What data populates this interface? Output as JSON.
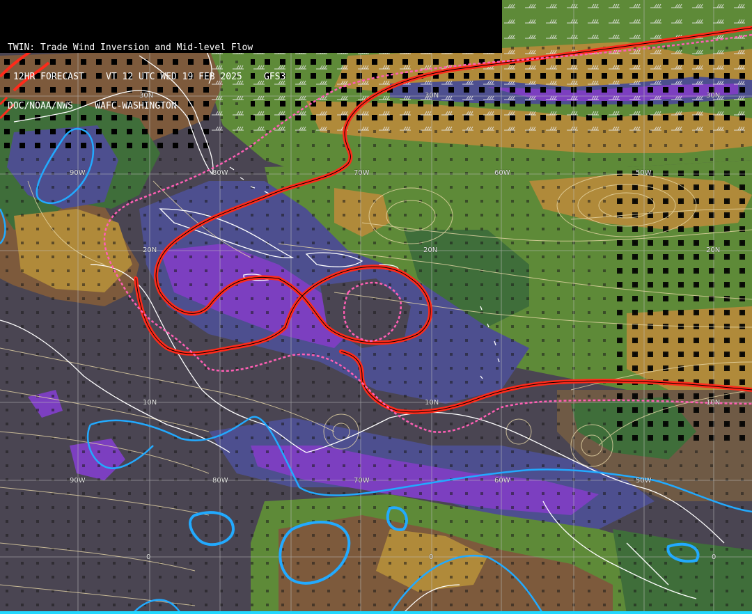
{
  "header": {
    "line1": "TWIN: Trade Wind Inversion and Mid-level Flow",
    "line2": "12HR FORECAST    VT 12 UTC WED 19 FEB 2025    GFS3",
    "line3": "DOC/NOAA/NWS    WAFC-WASHINGTON"
  },
  "grid_labels": {
    "lat_30n_a": "30N",
    "lat_30n_b": "30N",
    "lat_30n_c": "30N",
    "lon_90w_top": "90W",
    "lon_80w_top": "80W",
    "lon_70w_top": "70W",
    "lon_60w_top": "60W",
    "lon_50w_top": "50W",
    "lat_20n_a": "20N",
    "lat_20n_b": "20N",
    "lat_20n_c": "20N",
    "lat_10n_a": "10N",
    "lat_10n_b": "10N",
    "lat_10n_c": "10N",
    "lon_90w_bot": "90W",
    "lon_80w_bot": "80W",
    "lon_70w_bot": "70W",
    "lon_60w_bot": "60W",
    "lon_50w_bot": "50W",
    "eq_a": "0",
    "eq_b": "0",
    "eq_c": "0"
  },
  "colors": {
    "background_dark": "#4a4552",
    "brown": "#7d5a3c",
    "tan": "#b08a3a",
    "green_light": "#5e8a38",
    "green_dark": "#3f6e3a",
    "blue_purple": "#4d4f8f",
    "purple": "#7c3fc0",
    "contour_red": "#ff2a1a",
    "contour_pink": "#ff5fb4",
    "contour_cyan": "#22aaff",
    "coastline": "#ffffff",
    "streamline": "#e8d8a8"
  },
  "legend": {
    "title_text": "TWIN: Trade Wind Inversion and Mid-level Flow"
  }
}
